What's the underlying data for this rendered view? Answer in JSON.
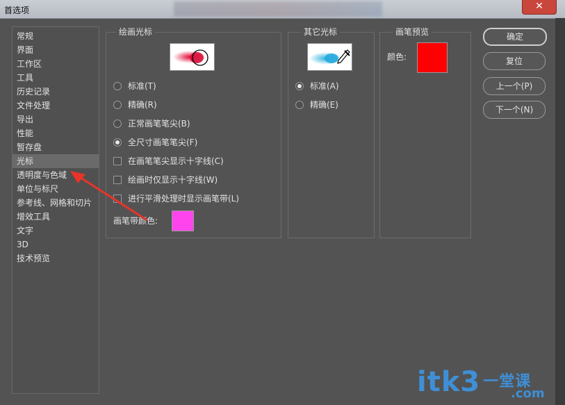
{
  "window": {
    "title": "首选项",
    "close_glyph": "✕"
  },
  "sidebar": {
    "items": [
      {
        "label": "常规"
      },
      {
        "label": "界面"
      },
      {
        "label": "工作区"
      },
      {
        "label": "工具"
      },
      {
        "label": "历史记录"
      },
      {
        "label": "文件处理"
      },
      {
        "label": "导出"
      },
      {
        "label": "性能"
      },
      {
        "label": "暂存盘"
      },
      {
        "label": "光标",
        "active": true
      },
      {
        "label": "透明度与色域"
      },
      {
        "label": "单位与标尺"
      },
      {
        "label": "参考线、网格和切片"
      },
      {
        "label": "增效工具"
      },
      {
        "label": "文字"
      },
      {
        "label": "3D"
      },
      {
        "label": "技术预览"
      }
    ]
  },
  "painting_cursors": {
    "legend": "绘画光标",
    "options": [
      {
        "label": "标准(T)",
        "selected": false
      },
      {
        "label": "精确(R)",
        "selected": false
      },
      {
        "label": "正常画笔笔尖(B)",
        "selected": false
      },
      {
        "label": "全尺寸画笔笔尖(F)",
        "selected": true
      }
    ],
    "checkboxes": [
      {
        "label": "在画笔笔尖显示十字线(C)",
        "checked": false
      },
      {
        "label": "绘画时仅显示十字线(W)",
        "checked": false
      },
      {
        "label": "进行平滑处理时显示画笔带(L)",
        "checked": false
      }
    ],
    "leash_color_label": "画笔带颜色:",
    "leash_color": "#ff44ee"
  },
  "other_cursors": {
    "legend": "其它光标",
    "options": [
      {
        "label": "标准(A)",
        "selected": true
      },
      {
        "label": "精确(E)",
        "selected": false
      }
    ]
  },
  "brush_preview": {
    "legend": "画笔预览",
    "color_label": "颜色:",
    "color": "#ff0000"
  },
  "buttons": {
    "ok": "确定",
    "reset": "复位",
    "prev": "上一个(P)",
    "next": "下一个(N)"
  },
  "watermark": {
    "text": "itk3",
    "sub": "一堂课",
    "domain": ".com"
  }
}
